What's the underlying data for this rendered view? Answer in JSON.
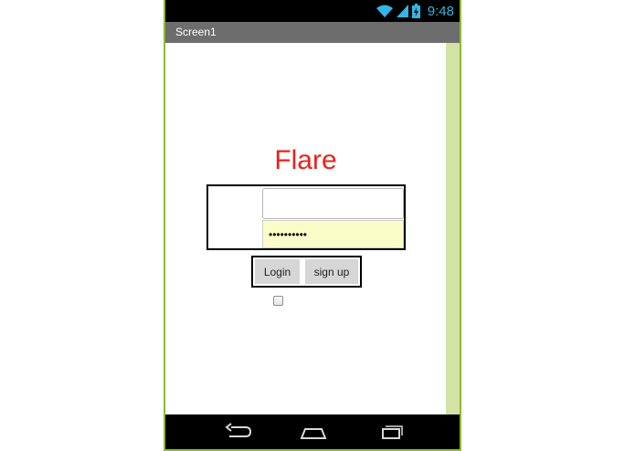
{
  "status_bar": {
    "time": "9:48",
    "accent_color": "#33b5e5",
    "icons": [
      "wifi-icon",
      "cellular-signal-icon",
      "battery-icon"
    ]
  },
  "screen": {
    "title": "Screen1"
  },
  "form": {
    "app_title": "Flare",
    "app_title_color": "#e8221b",
    "username_value": "",
    "password_value": "••••••••••",
    "login_label": "Login",
    "signup_label": "sign up",
    "checkbox_checked": false
  },
  "nav_bar": {
    "buttons": [
      "back-icon",
      "home-icon",
      "recent-apps-icon"
    ]
  },
  "colors": {
    "frame_border": "#8fb834",
    "scroll_strip": "#d3e3a6",
    "title_bar": "#6d6d6d",
    "password_bg": "#fafdc8"
  }
}
